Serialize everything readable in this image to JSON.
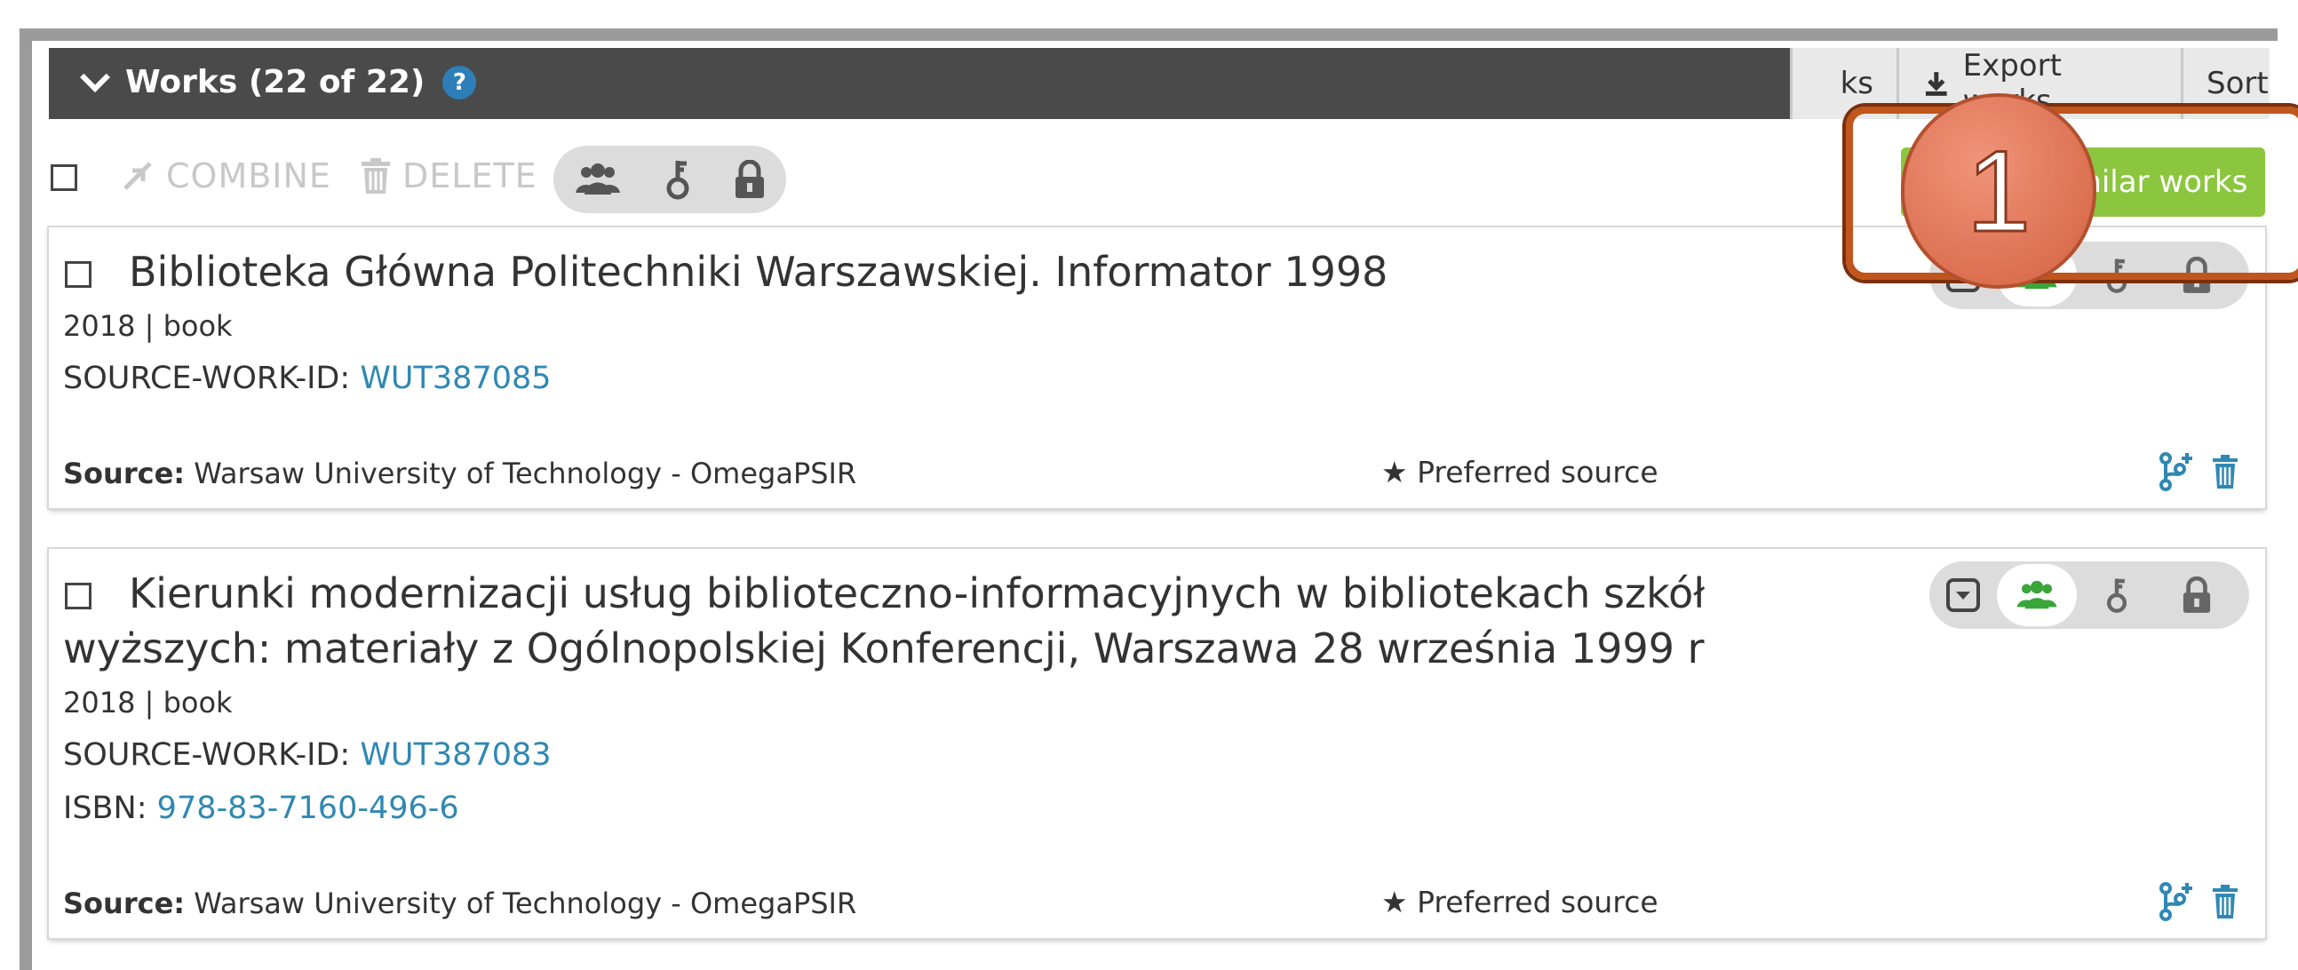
{
  "header": {
    "title": "Works (22 of 22)",
    "help_glyph": "?",
    "partial_btn": "ks",
    "export_label": "Export works",
    "sort_label": "Sort"
  },
  "toolbar": {
    "combine_label": "COMBINE",
    "delete_label": "DELETE",
    "manage_label": "Manage similar works"
  },
  "works": [
    {
      "title": "Biblioteka Główna Politechniki Warszawskiej. Informator 1998",
      "year_type": "2018 | book",
      "source_id_label": "SOURCE-WORK-ID:",
      "source_id": "WUT387085",
      "source_label": "Source:",
      "source": "Warsaw University of Technology - OmegaPSIR",
      "preferred": "Preferred source"
    },
    {
      "title_line1": "Kierunki modernizacji usług biblioteczno-informacyjnych w bibliotekach szkół",
      "title_line2": "wyższych: materiały z Ogólnopolskiej Konferencji, Warszawa 28 września 1999 r",
      "year_type": "2018 | book",
      "source_id_label": "SOURCE-WORK-ID:",
      "source_id": "WUT387083",
      "isbn_label": "ISBN:",
      "isbn": "978-83-7160-496-6",
      "source_label": "Source:",
      "source": "Warsaw University of Technology - OmegaPSIR",
      "preferred": "Preferred source"
    }
  ],
  "callout": {
    "number": "1",
    "color": "#e07a5c",
    "outline": "#c0561c"
  },
  "colors": {
    "accent_green": "#8cc63f",
    "link": "#2f88b3",
    "header_bg": "#4a4a4a",
    "visibility_green": "#3aa63a"
  }
}
